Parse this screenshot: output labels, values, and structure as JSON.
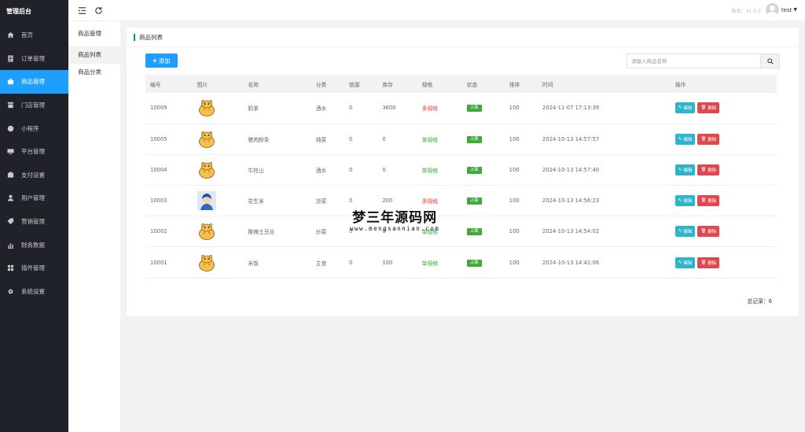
{
  "app": {
    "title": "管理后台",
    "version": "版本：V1.0.3",
    "user": "test"
  },
  "sidebar": {
    "items": [
      {
        "label": "首页",
        "icon": "home-icon"
      },
      {
        "label": "订单管理",
        "icon": "order-icon"
      },
      {
        "label": "商品管理",
        "icon": "goods-icon",
        "active": true
      },
      {
        "label": "门店管理",
        "icon": "store-icon"
      },
      {
        "label": "小程序",
        "icon": "miniprogram-icon"
      },
      {
        "label": "平台管理",
        "icon": "platform-icon"
      },
      {
        "label": "支付设置",
        "icon": "payment-icon"
      },
      {
        "label": "用户管理",
        "icon": "user-icon"
      },
      {
        "label": "营销管理",
        "icon": "tag-icon"
      },
      {
        "label": "财务数据",
        "icon": "chart-icon"
      },
      {
        "label": "插件管理",
        "icon": "plugin-icon"
      },
      {
        "label": "系统设置",
        "icon": "gear-icon"
      }
    ]
  },
  "submenu": {
    "title": "商品管理",
    "items": [
      {
        "label": "商品列表",
        "active": true
      },
      {
        "label": "商品分类"
      }
    ]
  },
  "panel": {
    "title": "商品列表",
    "add_label": "添加",
    "search_placeholder": "请输入商品名称",
    "total_label": "总记录：6"
  },
  "table": {
    "headers": [
      "编号",
      "图片",
      "名称",
      "分类",
      "销量",
      "库存",
      "规格",
      "状态",
      "排序",
      "时间",
      "操作"
    ],
    "rows": [
      {
        "id": "10009",
        "image": "hippo",
        "name": "奶茶",
        "category": "酒水",
        "sales": "0",
        "stock": "3600",
        "spec": "多规格",
        "spec_type": "multi",
        "status": "上架",
        "sort": "100",
        "time": "2024-11-07 17:13:39"
      },
      {
        "id": "10005",
        "image": "hippo",
        "name": "猪肉粉条",
        "category": "炖菜",
        "sales": "0",
        "stock": "0",
        "spec": "单规格",
        "spec_type": "single",
        "status": "上架",
        "sort": "100",
        "time": "2024-10-13 14:57:57"
      },
      {
        "id": "10004",
        "image": "hippo",
        "name": "牛柱山",
        "category": "酒水",
        "sales": "0",
        "stock": "0",
        "spec": "单规格",
        "spec_type": "single",
        "status": "上架",
        "sort": "100",
        "time": "2024-10-13 14:57:40"
      },
      {
        "id": "10003",
        "image": "avatar",
        "name": "花生米",
        "category": "凉菜",
        "sales": "0",
        "stock": "200",
        "spec": "多规格",
        "spec_type": "multi",
        "status": "上架",
        "sort": "100",
        "time": "2024-10-13 14:56:23"
      },
      {
        "id": "10002",
        "image": "hippo",
        "name": "酸辣土豆丝",
        "category": "炒菜",
        "sales": "0",
        "stock": "0",
        "spec": "单规格",
        "spec_type": "single",
        "status": "上架",
        "sort": "100",
        "time": "2024-10-13 14:54:02"
      },
      {
        "id": "10001",
        "image": "hippo",
        "name": "米饭",
        "category": "主食",
        "sales": "0",
        "stock": "100",
        "spec": "单规格",
        "spec_type": "single",
        "status": "上架",
        "sort": "100",
        "time": "2024-10-13 14:41:06"
      }
    ],
    "edit_label": "编辑",
    "delete_label": "删除"
  },
  "watermark": {
    "title": "梦三年源码网",
    "url": "www.mengsannian.com"
  },
  "colors": {
    "sidebar_bg": "#20222a",
    "accent": "#1e9fff",
    "status_green": "#3faa3a",
    "multi_red": "#ff3030",
    "edit_cyan": "#2fb5c9",
    "delete_red": "#e0474f"
  }
}
